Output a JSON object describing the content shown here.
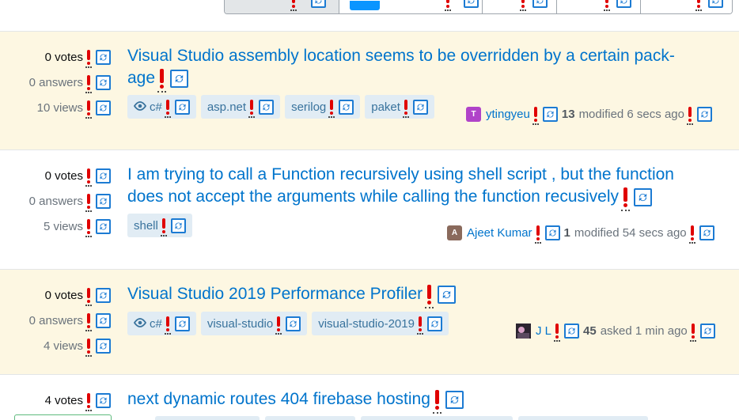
{
  "questions": [
    {
      "votes": "0 votes",
      "answers": "0 answers",
      "views": "10 views",
      "title": "Visual Studio assembly location seems to be overridden by a certain package",
      "title_line1": "Visual Studio assembly location seems to be overridden by a certain pack-",
      "title_line2": "age",
      "tags": [
        "c#",
        "asp.net",
        "serilog",
        "paket"
      ],
      "user": "ytingyeu",
      "avatar_letter": "T",
      "avatar_color": "#b043c9",
      "rep": "13",
      "action": "modified 6 secs ago"
    },
    {
      "votes": "0 votes",
      "answers": "0 answers",
      "views": "5 views",
      "title_line1": "I am trying to call a Function recursively using shell script , but the function",
      "title_line2": "does not accept the arguments while calling the function recusively",
      "tags": [
        "shell"
      ],
      "user": "Ajeet Kumar",
      "avatar_letter": "A",
      "avatar_color": "#8a6a5c",
      "rep": "1",
      "action": "modified 54 secs ago"
    },
    {
      "votes": "0 votes",
      "answers": "0 answers",
      "views": "4 views",
      "title_line1": "Visual Studio 2019 Performance Profiler",
      "tags": [
        "c#",
        "visual-studio",
        "visual-studio-2019"
      ],
      "user": "J L",
      "avatar_color": "#3a3240",
      "rep": "45",
      "action": "asked 1 min ago"
    },
    {
      "votes": "4 votes",
      "title_line1": "next dynamic routes 404 firebase hosting"
    }
  ],
  "icons": {
    "marker": "exclamation-marker-icon",
    "sync": "sync-icon",
    "watched": "eye-icon"
  }
}
